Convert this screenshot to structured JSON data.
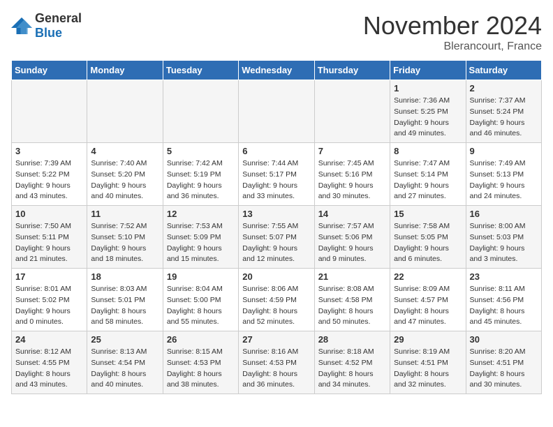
{
  "header": {
    "logo_general": "General",
    "logo_blue": "Blue",
    "month": "November 2024",
    "location": "Blerancourt, France"
  },
  "days_of_week": [
    "Sunday",
    "Monday",
    "Tuesday",
    "Wednesday",
    "Thursday",
    "Friday",
    "Saturday"
  ],
  "weeks": [
    [
      {
        "day": "",
        "sunrise": "",
        "sunset": "",
        "daylight": ""
      },
      {
        "day": "",
        "sunrise": "",
        "sunset": "",
        "daylight": ""
      },
      {
        "day": "",
        "sunrise": "",
        "sunset": "",
        "daylight": ""
      },
      {
        "day": "",
        "sunrise": "",
        "sunset": "",
        "daylight": ""
      },
      {
        "day": "",
        "sunrise": "",
        "sunset": "",
        "daylight": ""
      },
      {
        "day": "1",
        "sunrise": "Sunrise: 7:36 AM",
        "sunset": "Sunset: 5:25 PM",
        "daylight": "Daylight: 9 hours and 49 minutes."
      },
      {
        "day": "2",
        "sunrise": "Sunrise: 7:37 AM",
        "sunset": "Sunset: 5:24 PM",
        "daylight": "Daylight: 9 hours and 46 minutes."
      }
    ],
    [
      {
        "day": "3",
        "sunrise": "Sunrise: 7:39 AM",
        "sunset": "Sunset: 5:22 PM",
        "daylight": "Daylight: 9 hours and 43 minutes."
      },
      {
        "day": "4",
        "sunrise": "Sunrise: 7:40 AM",
        "sunset": "Sunset: 5:20 PM",
        "daylight": "Daylight: 9 hours and 40 minutes."
      },
      {
        "day": "5",
        "sunrise": "Sunrise: 7:42 AM",
        "sunset": "Sunset: 5:19 PM",
        "daylight": "Daylight: 9 hours and 36 minutes."
      },
      {
        "day": "6",
        "sunrise": "Sunrise: 7:44 AM",
        "sunset": "Sunset: 5:17 PM",
        "daylight": "Daylight: 9 hours and 33 minutes."
      },
      {
        "day": "7",
        "sunrise": "Sunrise: 7:45 AM",
        "sunset": "Sunset: 5:16 PM",
        "daylight": "Daylight: 9 hours and 30 minutes."
      },
      {
        "day": "8",
        "sunrise": "Sunrise: 7:47 AM",
        "sunset": "Sunset: 5:14 PM",
        "daylight": "Daylight: 9 hours and 27 minutes."
      },
      {
        "day": "9",
        "sunrise": "Sunrise: 7:49 AM",
        "sunset": "Sunset: 5:13 PM",
        "daylight": "Daylight: 9 hours and 24 minutes."
      }
    ],
    [
      {
        "day": "10",
        "sunrise": "Sunrise: 7:50 AM",
        "sunset": "Sunset: 5:11 PM",
        "daylight": "Daylight: 9 hours and 21 minutes."
      },
      {
        "day": "11",
        "sunrise": "Sunrise: 7:52 AM",
        "sunset": "Sunset: 5:10 PM",
        "daylight": "Daylight: 9 hours and 18 minutes."
      },
      {
        "day": "12",
        "sunrise": "Sunrise: 7:53 AM",
        "sunset": "Sunset: 5:09 PM",
        "daylight": "Daylight: 9 hours and 15 minutes."
      },
      {
        "day": "13",
        "sunrise": "Sunrise: 7:55 AM",
        "sunset": "Sunset: 5:07 PM",
        "daylight": "Daylight: 9 hours and 12 minutes."
      },
      {
        "day": "14",
        "sunrise": "Sunrise: 7:57 AM",
        "sunset": "Sunset: 5:06 PM",
        "daylight": "Daylight: 9 hours and 9 minutes."
      },
      {
        "day": "15",
        "sunrise": "Sunrise: 7:58 AM",
        "sunset": "Sunset: 5:05 PM",
        "daylight": "Daylight: 9 hours and 6 minutes."
      },
      {
        "day": "16",
        "sunrise": "Sunrise: 8:00 AM",
        "sunset": "Sunset: 5:03 PM",
        "daylight": "Daylight: 9 hours and 3 minutes."
      }
    ],
    [
      {
        "day": "17",
        "sunrise": "Sunrise: 8:01 AM",
        "sunset": "Sunset: 5:02 PM",
        "daylight": "Daylight: 9 hours and 0 minutes."
      },
      {
        "day": "18",
        "sunrise": "Sunrise: 8:03 AM",
        "sunset": "Sunset: 5:01 PM",
        "daylight": "Daylight: 8 hours and 58 minutes."
      },
      {
        "day": "19",
        "sunrise": "Sunrise: 8:04 AM",
        "sunset": "Sunset: 5:00 PM",
        "daylight": "Daylight: 8 hours and 55 minutes."
      },
      {
        "day": "20",
        "sunrise": "Sunrise: 8:06 AM",
        "sunset": "Sunset: 4:59 PM",
        "daylight": "Daylight: 8 hours and 52 minutes."
      },
      {
        "day": "21",
        "sunrise": "Sunrise: 8:08 AM",
        "sunset": "Sunset: 4:58 PM",
        "daylight": "Daylight: 8 hours and 50 minutes."
      },
      {
        "day": "22",
        "sunrise": "Sunrise: 8:09 AM",
        "sunset": "Sunset: 4:57 PM",
        "daylight": "Daylight: 8 hours and 47 minutes."
      },
      {
        "day": "23",
        "sunrise": "Sunrise: 8:11 AM",
        "sunset": "Sunset: 4:56 PM",
        "daylight": "Daylight: 8 hours and 45 minutes."
      }
    ],
    [
      {
        "day": "24",
        "sunrise": "Sunrise: 8:12 AM",
        "sunset": "Sunset: 4:55 PM",
        "daylight": "Daylight: 8 hours and 43 minutes."
      },
      {
        "day": "25",
        "sunrise": "Sunrise: 8:13 AM",
        "sunset": "Sunset: 4:54 PM",
        "daylight": "Daylight: 8 hours and 40 minutes."
      },
      {
        "day": "26",
        "sunrise": "Sunrise: 8:15 AM",
        "sunset": "Sunset: 4:53 PM",
        "daylight": "Daylight: 8 hours and 38 minutes."
      },
      {
        "day": "27",
        "sunrise": "Sunrise: 8:16 AM",
        "sunset": "Sunset: 4:53 PM",
        "daylight": "Daylight: 8 hours and 36 minutes."
      },
      {
        "day": "28",
        "sunrise": "Sunrise: 8:18 AM",
        "sunset": "Sunset: 4:52 PM",
        "daylight": "Daylight: 8 hours and 34 minutes."
      },
      {
        "day": "29",
        "sunrise": "Sunrise: 8:19 AM",
        "sunset": "Sunset: 4:51 PM",
        "daylight": "Daylight: 8 hours and 32 minutes."
      },
      {
        "day": "30",
        "sunrise": "Sunrise: 8:20 AM",
        "sunset": "Sunset: 4:51 PM",
        "daylight": "Daylight: 8 hours and 30 minutes."
      }
    ]
  ]
}
